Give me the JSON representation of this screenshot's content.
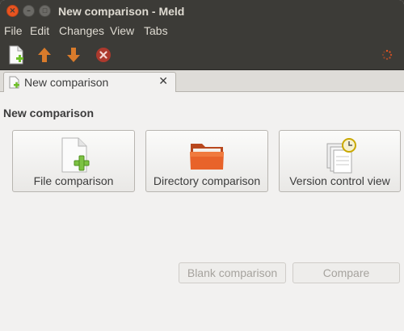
{
  "window": {
    "title": "New comparison - Meld"
  },
  "menubar": {
    "items": [
      "File",
      "Edit",
      "Changes",
      "View",
      "Tabs"
    ]
  },
  "toolbar": {
    "icons": [
      "new-document-icon",
      "arrow-up-icon",
      "arrow-down-icon",
      "stop-icon",
      "spinner-icon"
    ]
  },
  "tab": {
    "label": "New comparison",
    "close_glyph": "✕"
  },
  "main": {
    "heading": "New comparison",
    "options": [
      {
        "label": "File comparison",
        "icon": "file-add-icon"
      },
      {
        "label": "Directory comparison",
        "icon": "folder-icon"
      },
      {
        "label": "Version control view",
        "icon": "version-control-icon"
      }
    ],
    "blank_label": "Blank comparison",
    "compare_label": "Compare",
    "blank_enabled": false,
    "compare_enabled": false
  },
  "colors": {
    "accent": "#e95420",
    "header": "#3c3b37",
    "surface": "#f2f1f0"
  }
}
